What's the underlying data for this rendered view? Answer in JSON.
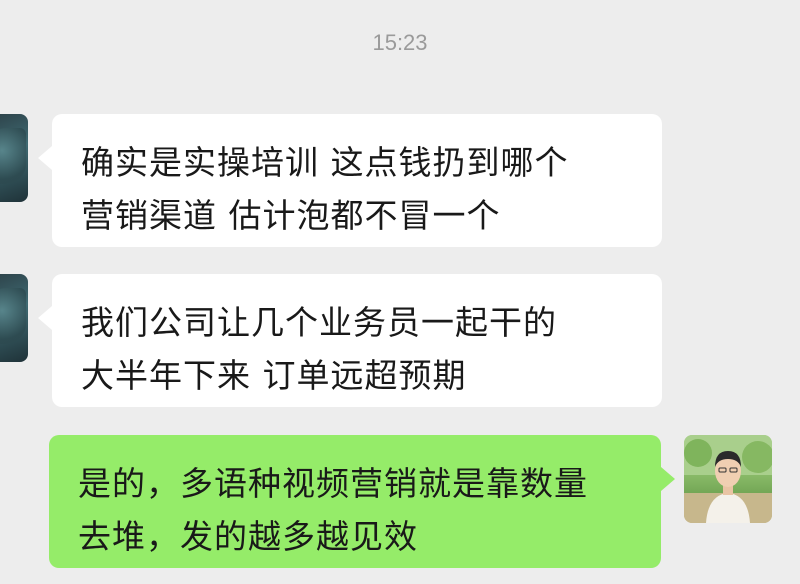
{
  "chat": {
    "timestamp": "15:23",
    "messages": [
      {
        "side": "left",
        "avatar": "contact-avatar",
        "lines": [
          "确实是实操培训 这点钱扔到哪个",
          "营销渠道 估计泡都不冒一个"
        ]
      },
      {
        "side": "left",
        "avatar": "contact-avatar",
        "lines": [
          "我们公司让几个业务员一起干的",
          "大半年下来 订单远超预期"
        ]
      },
      {
        "side": "right",
        "avatar": "my-avatar",
        "lines": [
          "是的，多语种视频营销就是靠数量",
          "去堆，发的越多越见效"
        ]
      }
    ]
  },
  "colors": {
    "background": "#ededed",
    "incoming_bubble": "#ffffff",
    "outgoing_bubble": "#95ec69",
    "timestamp_text": "#9a9a9a"
  }
}
